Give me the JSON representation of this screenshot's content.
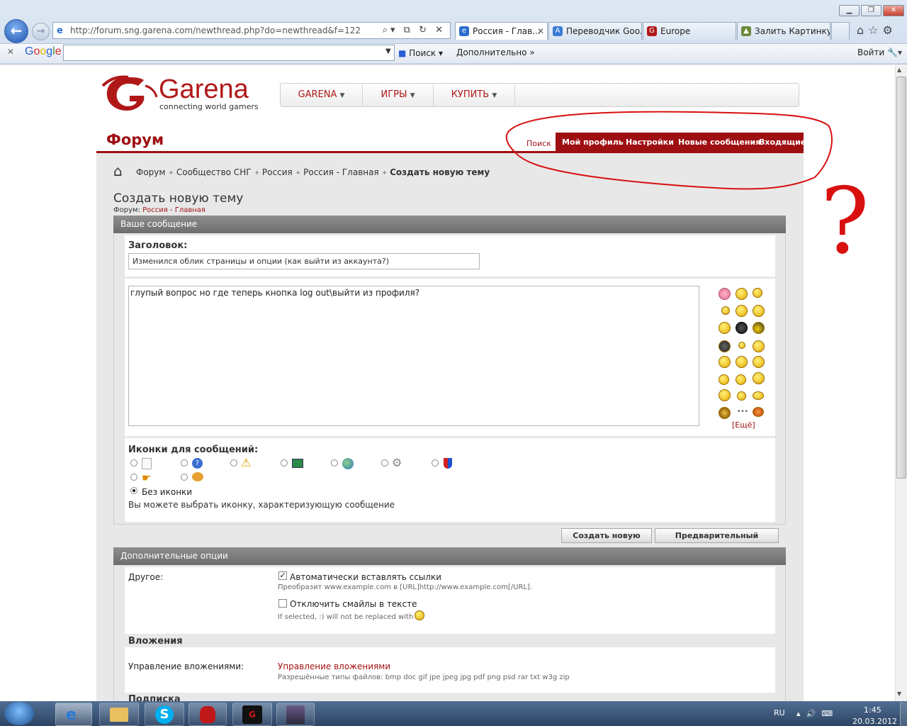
{
  "browser": {
    "url": "http://forum.sng.garena.com/newthread.php?do=newthread&f=122",
    "tabs": [
      {
        "label": "Россия - Глав...",
        "active": true
      },
      {
        "label": "Переводчик Goo..."
      },
      {
        "label": "Europe"
      },
      {
        "label": "Залить Картинку..."
      }
    ],
    "google_label": "Google",
    "search_button": "Поиск",
    "more_label": "Дополнительно",
    "signin": "Войти"
  },
  "site": {
    "logo_name": "Garena",
    "logo_tagline": "connecting world gamers",
    "nav": [
      "GARENA",
      "ИГРЫ",
      "КУПИТЬ"
    ],
    "forum_title": "Форум",
    "links": [
      "Поиск",
      "Мой профиль",
      "Настройки",
      "Новые сообщения",
      "Входящие"
    ]
  },
  "breadcrumb": [
    "Форум",
    "Сообщество СНГ",
    "Россия",
    "Россия - Главная",
    "Создать новую тему"
  ],
  "page": {
    "title": "Создать новую тему",
    "forum_label": "Форум:",
    "forum_link": "Россия - Главная"
  },
  "message": {
    "section": "Ваше сообщение",
    "subject_label": "Заголовок:",
    "subject_value": "Изменился облик страницы и опции (как выйти из аккаунта?)",
    "body": "глупый вопрос но где теперь кнопка log out\\выйти из профиля?",
    "more_smilies": "[Ещё]",
    "icons_label": "Иконки для сообщений:",
    "no_icon": "Без иконки",
    "icons_hint": "Вы можете выбрать иконку, характеризующую сообщение"
  },
  "buttons": {
    "submit": "Создать новую тему",
    "preview": "Предварительный просмотр"
  },
  "options": {
    "section": "Дополнительные опции",
    "other_label": "Другое:",
    "auto_links": "Автоматически вставлять ссылки",
    "auto_links_hint": "Преобразит www.example.com в [URL]http://www.example.com[/URL].",
    "disable_smilies": "Отключить смайлы в тексте",
    "smilies_hint": "If selected, :) will not be replaced with",
    "attachments_head": "Вложения",
    "manage_label": "Управление вложениями:",
    "manage_link": "Управление вложениями",
    "allowed_types": "Разрешённые типы файлов: bmp doc gif jpe jpeg jpg pdf png psd rar txt w3g zip",
    "subscription_head": "Подписка"
  },
  "annotation": {
    "mark": "?"
  },
  "taskbar": {
    "lang": "RU",
    "time": "1:45",
    "date": "20.03.2012"
  },
  "colors": {
    "brand_red": "#9e0f12",
    "header_gray": "#7a7a7a",
    "link_red": "#a31212"
  }
}
